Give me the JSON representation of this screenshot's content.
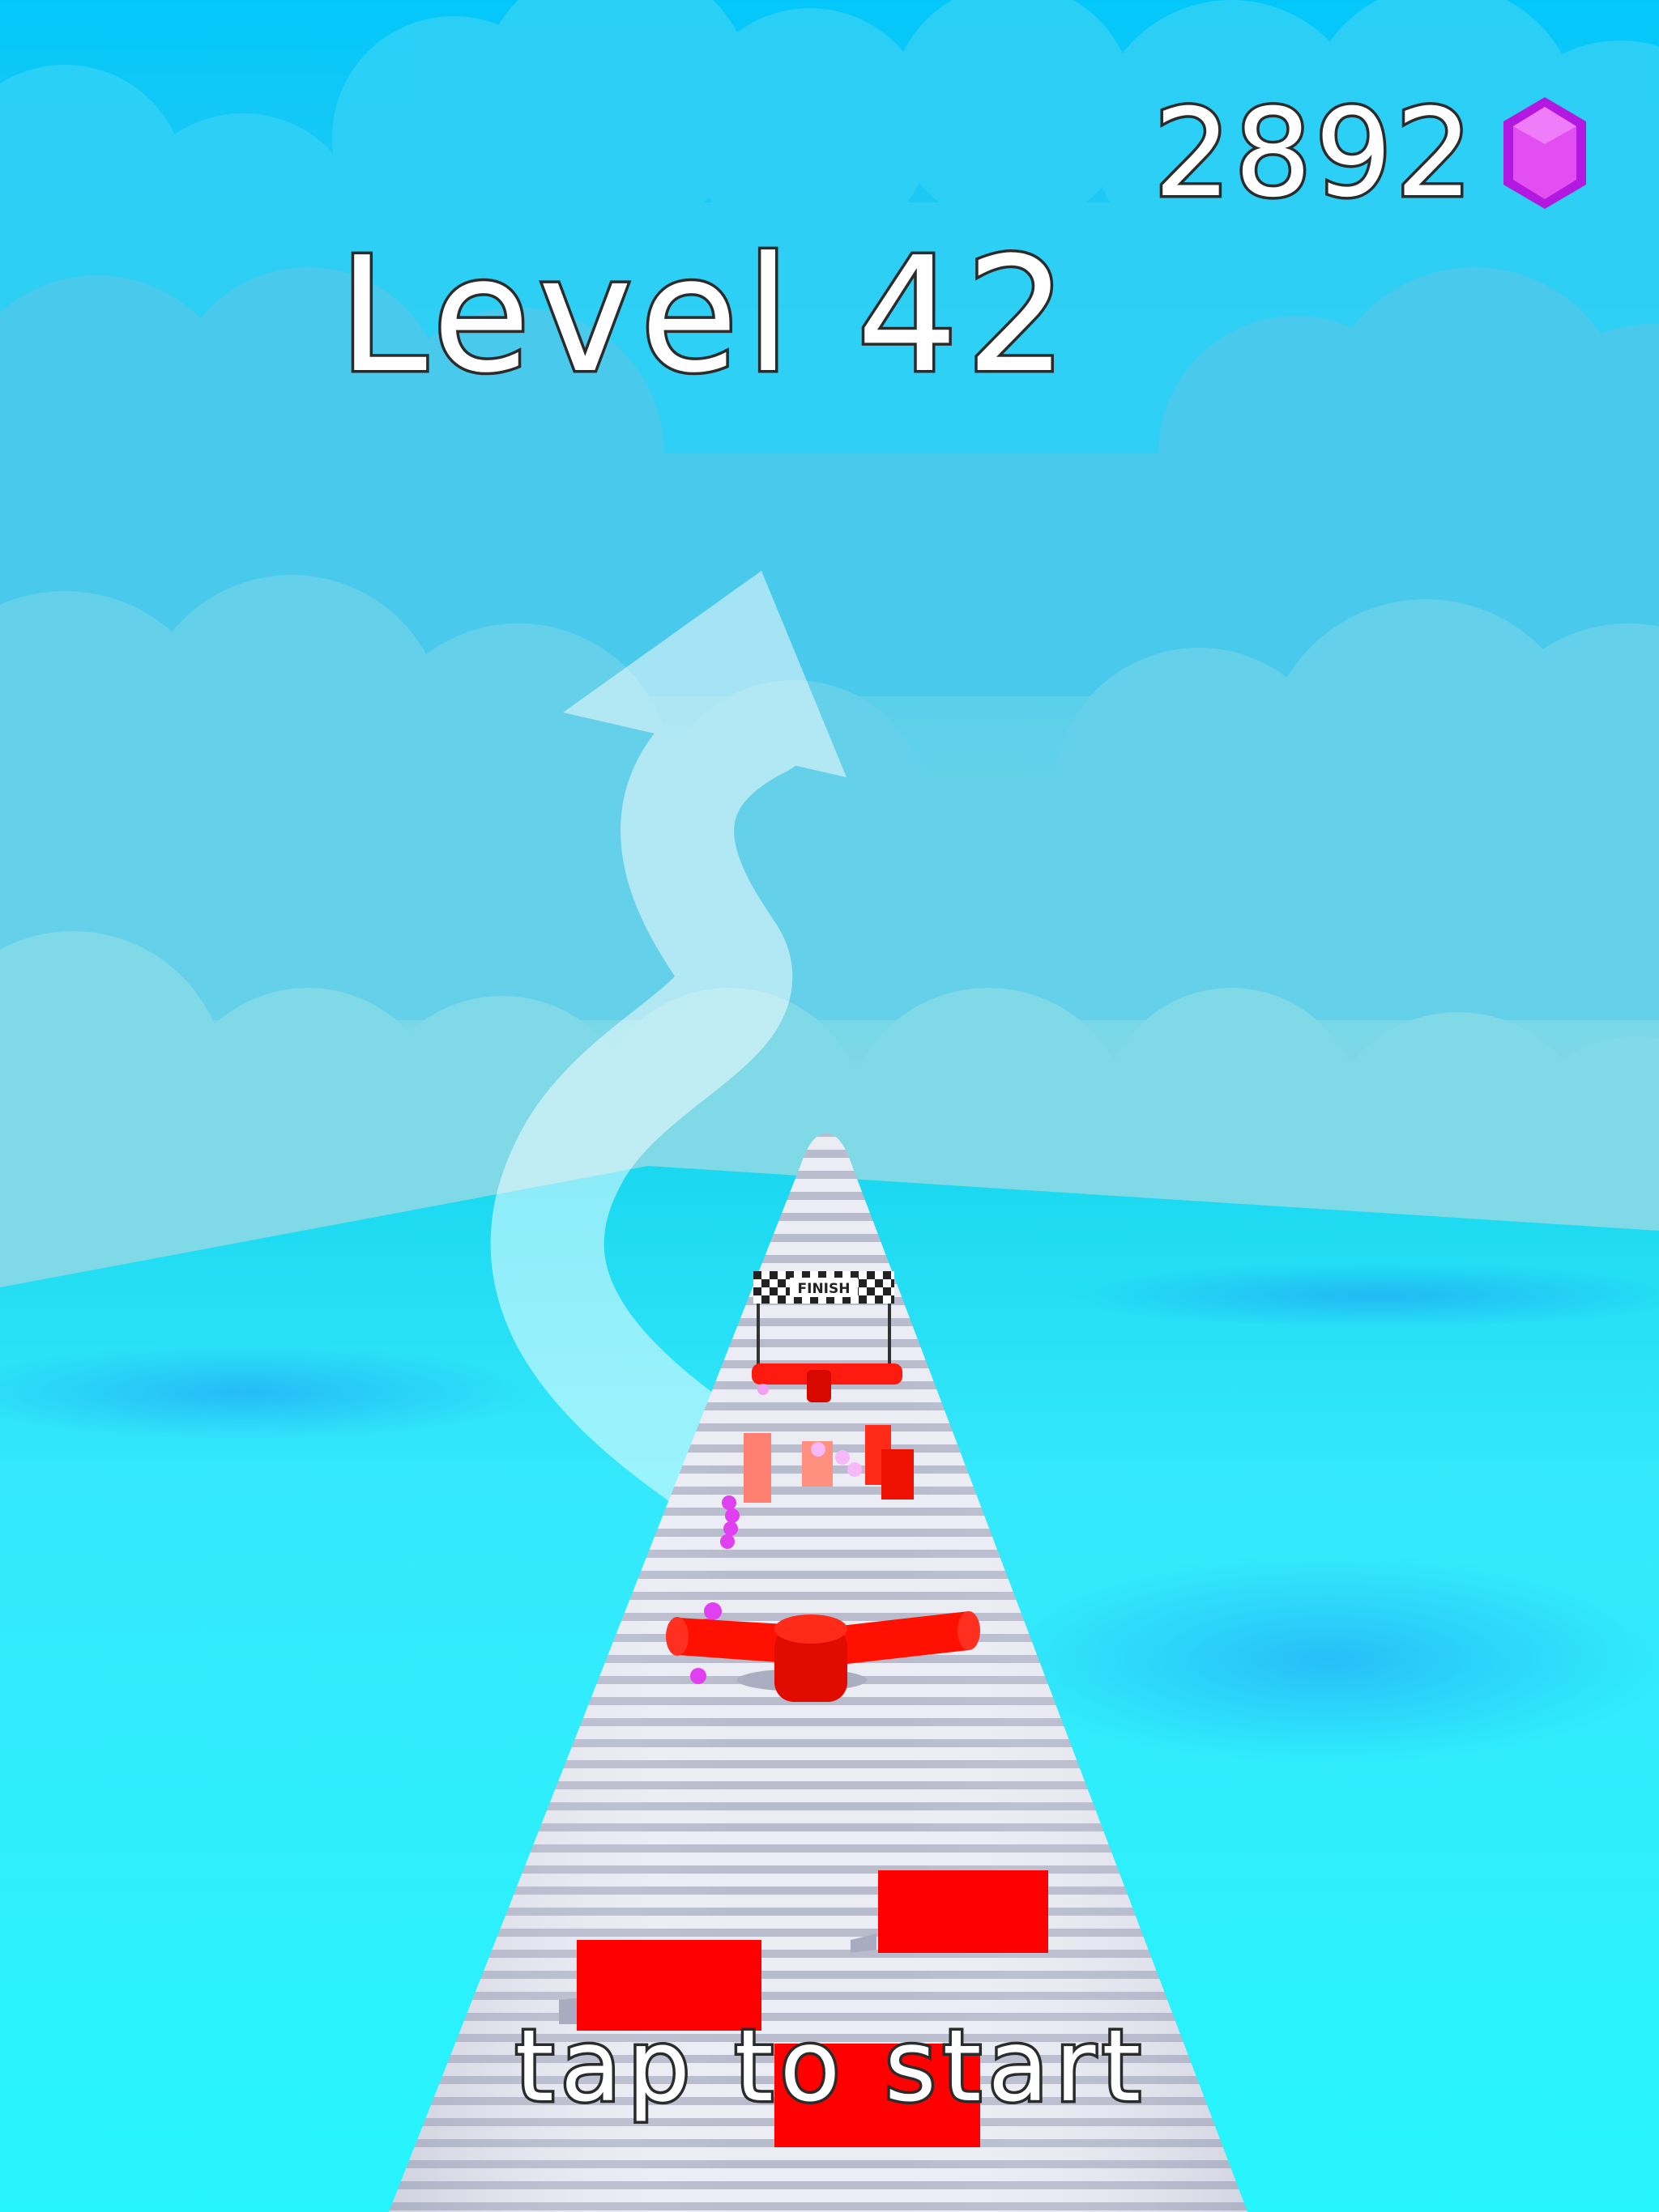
{
  "hud": {
    "gem_count": "2892",
    "gem_icon": "purple-gem-icon",
    "level_title": "Level 42",
    "start_prompt": "tap to start"
  },
  "scene": {
    "finish_banner": "FINISH",
    "colors": {
      "sky_top": "#05c8f8",
      "sky_bottom": "#83dbe6",
      "sea": "#2ff0fb",
      "track": "#e8e8f2",
      "track_stripe": "#b9bccb",
      "obstacle": "#ff0a00",
      "gem": "#d93cf0"
    }
  }
}
